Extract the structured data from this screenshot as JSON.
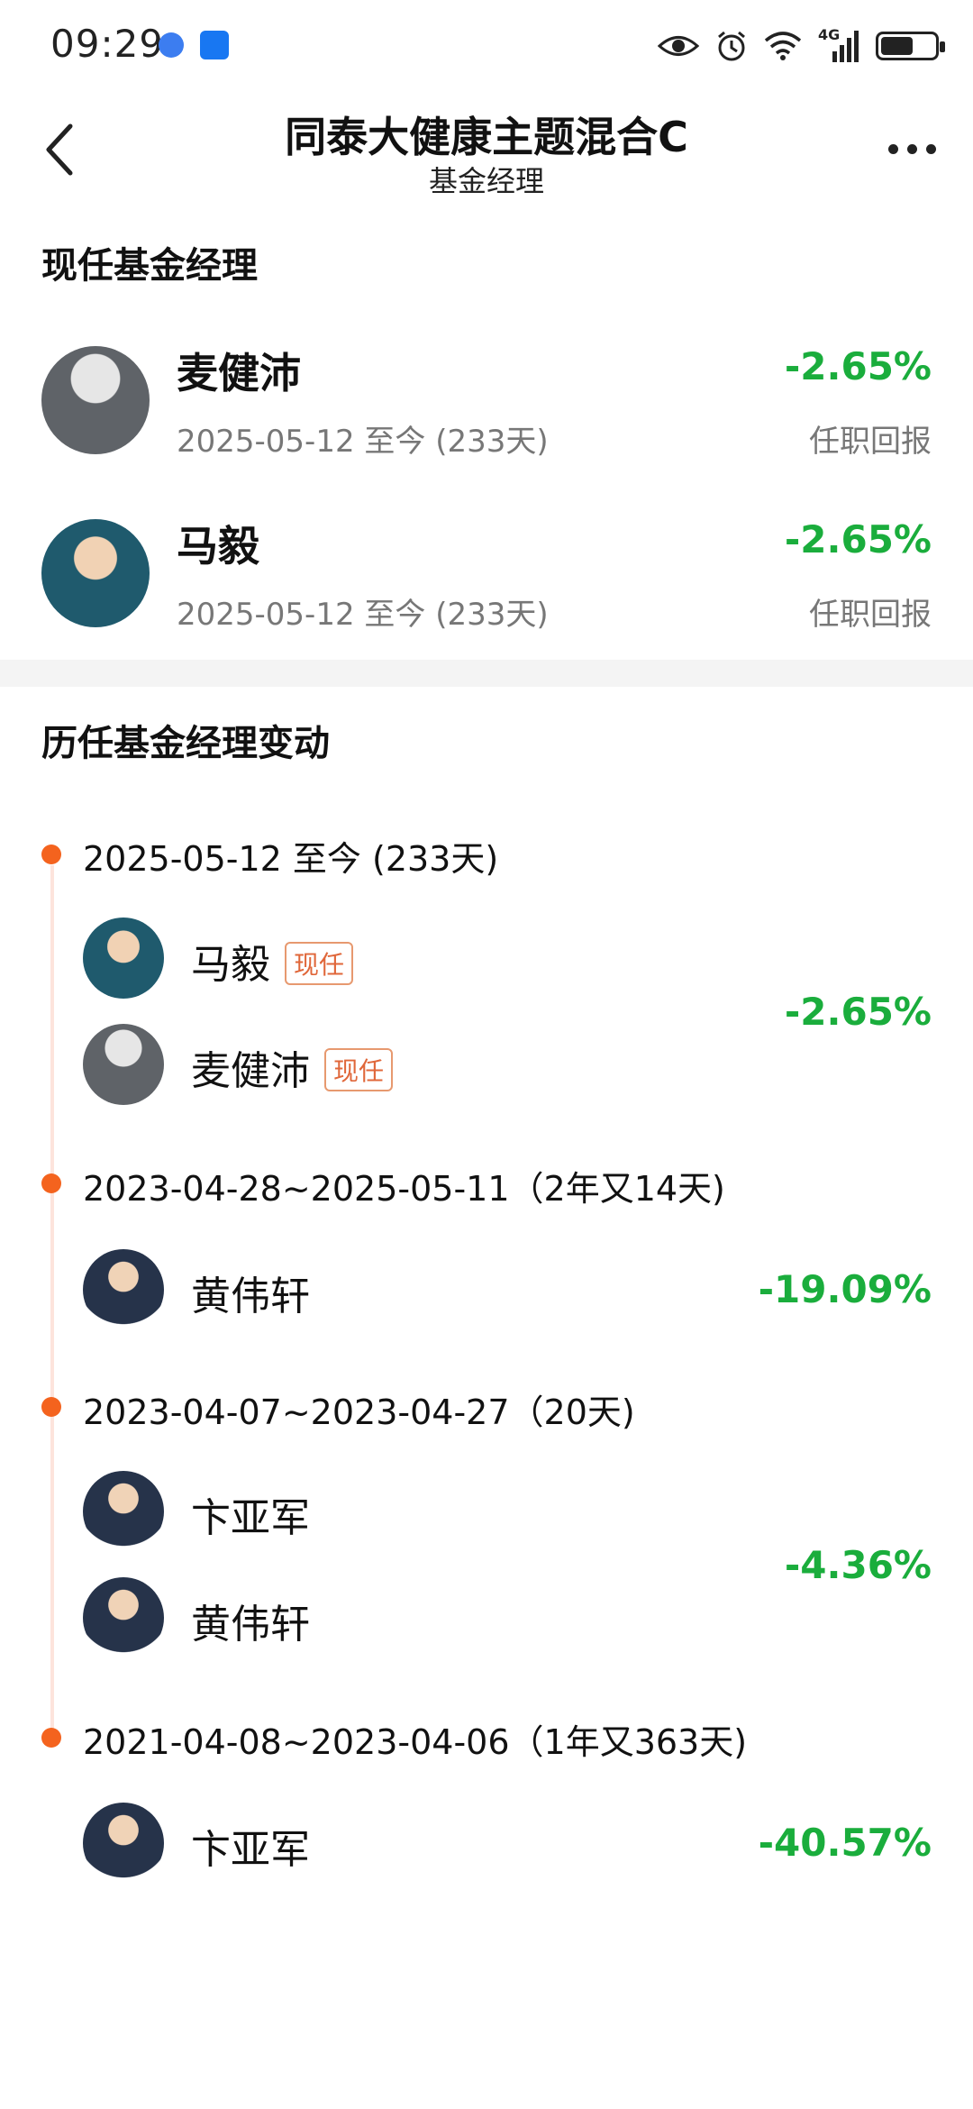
{
  "status_bar": {
    "time": "09:29",
    "network": "4G",
    "icons": [
      "browser-icon",
      "notification-app-icon",
      "eye-icon",
      "alarm-icon",
      "wifi-icon",
      "signal-icon",
      "battery-icon"
    ],
    "battery_level": 0.6
  },
  "header": {
    "title": "同泰大健康主题混合C",
    "subtitle": "基金经理"
  },
  "current_section": {
    "title": "现任基金经理",
    "managers": [
      {
        "name": "麦健沛",
        "tenure": "2025-05-12 至今 (233天)",
        "return": "-2.65%",
        "return_label": "任职回报",
        "avatar": "gray"
      },
      {
        "name": "马毅",
        "tenure": "2025-05-12 至今 (233天)",
        "return": "-2.65%",
        "return_label": "任职回报",
        "avatar": "teal"
      }
    ]
  },
  "history_section": {
    "title": "历任基金经理变动",
    "periods": [
      {
        "date": "2025-05-12 至今 (233天)",
        "return": "-2.65%",
        "managers": [
          {
            "name": "马毅",
            "badge": "现任"
          },
          {
            "name": "麦健沛",
            "badge": "现任"
          }
        ]
      },
      {
        "date": "2023-04-28~2025-05-11（2年又14天)",
        "return": "-19.09%",
        "managers": [
          {
            "name": "黄伟轩"
          }
        ]
      },
      {
        "date": "2023-04-07~2023-04-27（20天)",
        "return": "-4.36%",
        "managers": [
          {
            "name": "卞亚军"
          },
          {
            "name": "黄伟轩"
          }
        ]
      },
      {
        "date": "2021-04-08~2023-04-06（1年又363天)",
        "return": "-40.57%",
        "managers": [
          {
            "name": "卞亚军"
          }
        ]
      }
    ]
  },
  "colors": {
    "positive_green": "#1aad3c",
    "timeline_dot": "#f4631e",
    "badge": "#e0673a"
  }
}
